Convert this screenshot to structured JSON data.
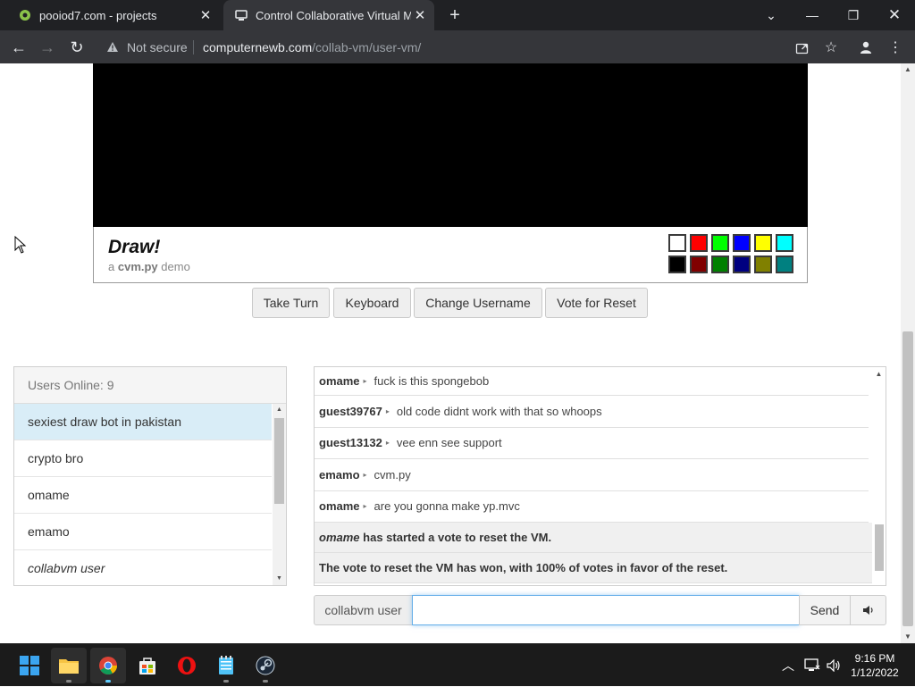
{
  "browser": {
    "tabs": [
      {
        "title": "pooiod7.com - projects",
        "active": false
      },
      {
        "title": "Control Collaborative Virtual Mac",
        "active": true
      }
    ],
    "security_label": "Not secure",
    "url_host": "computernewb.com",
    "url_path": "/collab-vm/user-vm/"
  },
  "vm": {
    "title": "Draw!",
    "subtitle_prefix": "a",
    "subtitle_bold": "cvm.py",
    "subtitle_suffix": "demo",
    "palette_row1": [
      "#ffffff",
      "#ff0000",
      "#00ff00",
      "#0000ff",
      "#ffff00",
      "#00ffff"
    ],
    "palette_row2": [
      "#000000",
      "#800000",
      "#008000",
      "#000080",
      "#808000",
      "#008080"
    ],
    "buttons": {
      "take_turn": "Take Turn",
      "keyboard": "Keyboard",
      "change_username": "Change Username",
      "vote_reset": "Vote for Reset"
    }
  },
  "users": {
    "header": "Users Online: 9",
    "list": [
      {
        "name": "sexiest draw bot in pakistan"
      },
      {
        "name": "crypto bro"
      },
      {
        "name": "omame"
      },
      {
        "name": "emamo"
      },
      {
        "name": "collabvm user"
      }
    ]
  },
  "chat": {
    "messages": [
      {
        "user": "omame",
        "text": "fuck is this spongebob"
      },
      {
        "user": "guest39767",
        "text": "old code didnt work with that so whoops"
      },
      {
        "user": "guest13132",
        "text": "vee enn see support"
      },
      {
        "user": "emamo",
        "text": "cvm.py"
      },
      {
        "user": "omame",
        "text": "are you gonna make yp.mvc"
      }
    ],
    "system_vote_user": "omame",
    "system_vote_text": "has started a vote to reset the VM.",
    "system_vote_result": "The vote to reset the VM has won, with 100% of votes in favor of the reset.",
    "username_label": "collabvm user",
    "input_value": "",
    "send_label": "Send"
  },
  "taskbar": {
    "time": "9:16 PM",
    "date": "1/12/2022"
  }
}
